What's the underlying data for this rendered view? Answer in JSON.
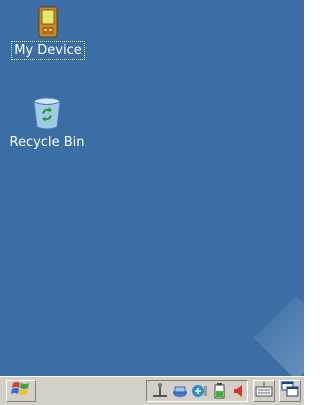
{
  "desktop": {
    "background_color": "#3a6ea5",
    "icons": [
      {
        "label": "My Device",
        "icon": "pda-device-icon",
        "selected": true
      },
      {
        "label": "Recycle Bin",
        "icon": "recycle-bin-icon",
        "selected": false
      }
    ]
  },
  "taskbar": {
    "start_icon": "windows-flag-icon",
    "tray_icons": [
      "usb-connection-icon",
      "network-icon",
      "wireless-icon",
      "battery-icon",
      "volume-icon"
    ],
    "keyboard_icon": "keyboard-icon",
    "windows_icon": "windows-switch-icon"
  }
}
